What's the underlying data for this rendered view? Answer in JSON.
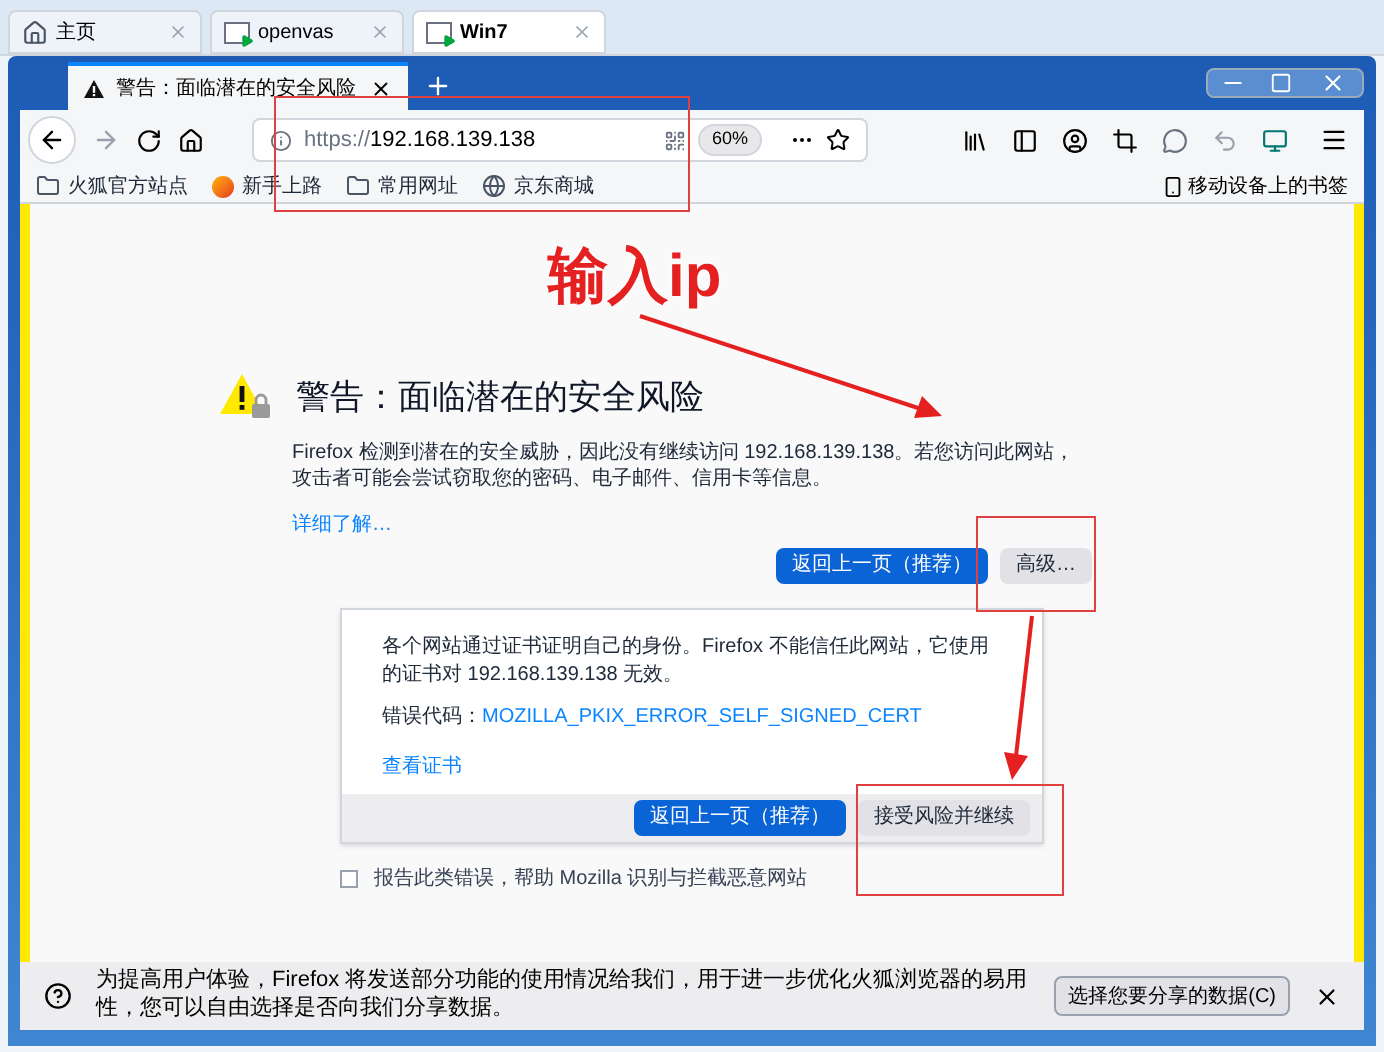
{
  "vm_tabs": [
    {
      "label": "主页",
      "selected": false,
      "kind": "home"
    },
    {
      "label": "openvas",
      "selected": false,
      "kind": "vm"
    },
    {
      "label": "Win7",
      "selected": true,
      "kind": "vm"
    }
  ],
  "browser_tab": {
    "title": "警告：面临潜在的安全风险"
  },
  "address_bar": {
    "scheme": "https://",
    "host": "192.168.139.138",
    "zoom": "60%"
  },
  "bookmarks": [
    {
      "label": "火狐官方站点",
      "kind": "folder"
    },
    {
      "label": "新手上路",
      "kind": "firefox"
    },
    {
      "label": "常用网址",
      "kind": "folder"
    },
    {
      "label": "京东商城",
      "kind": "globe"
    }
  ],
  "mobile_bookmarks": "移动设备上的书签",
  "warning": {
    "title": "警告：面临潜在的安全风险",
    "description": "Firefox 检测到潜在的安全威胁，因此没有继续访问 192.168.139.138。若您访问此网站，攻击者可能会尝试窃取您的密码、电子邮件、信用卡等信息。",
    "learn_more": "详细了解…",
    "buttons": [
      {
        "label": "返回上一页（推荐）",
        "primary": true
      },
      {
        "label": "高级…",
        "primary": false
      }
    ]
  },
  "advanced_panel": {
    "text": "各个网站通过证书证明自己的身份。Firefox 不能信任此网站，它使用的证书对 192.168.139.138 无效。",
    "error_label": "错误代码：",
    "error_code": "MOZILLA_PKIX_ERROR_SELF_SIGNED_CERT",
    "view_cert": "查看证书",
    "buttons": [
      {
        "label": "返回上一页（推荐）",
        "primary": true
      },
      {
        "label": "接受风险并继续",
        "primary": false
      }
    ]
  },
  "report": {
    "label": "报告此类错误，帮助 Mozilla 识别与拦截恶意网站",
    "checked": false
  },
  "notification": {
    "text": "为提高用户体验，Firefox 将发送部分功能的使用情况给我们，用于进一步优化火狐浏览器的易用性，您可以自由选择是否向我们分享数据。",
    "button": "选择您要分享的数据(C)"
  },
  "annotation": {
    "label": "输入ip"
  }
}
